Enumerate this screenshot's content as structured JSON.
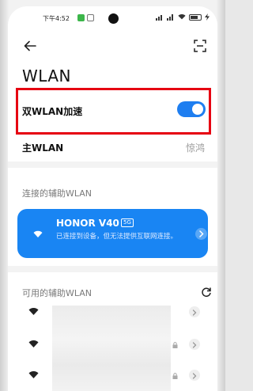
{
  "status_bar": {
    "time": "下午4:52"
  },
  "header": {
    "title": "WLAN"
  },
  "dual_wlan": {
    "label": "双WLAN加速",
    "enabled": true,
    "accent": "#1e7ef0",
    "highlight_color": "#e60012"
  },
  "main_wlan": {
    "label": "主WLAN",
    "value": "惊鸿"
  },
  "connected_section": {
    "title": "连接的辅助WLAN",
    "network": {
      "name": "HONOR V40",
      "band": "5G",
      "status": "已连接到设备，但无法提供互联网连接。",
      "card_color": "#1985f3"
    }
  },
  "available_section": {
    "title": "可用的辅助WLAN",
    "refresh_icon": "refresh-icon",
    "networks": [
      {
        "locked": false
      },
      {
        "locked": true
      },
      {
        "locked": true
      }
    ]
  }
}
